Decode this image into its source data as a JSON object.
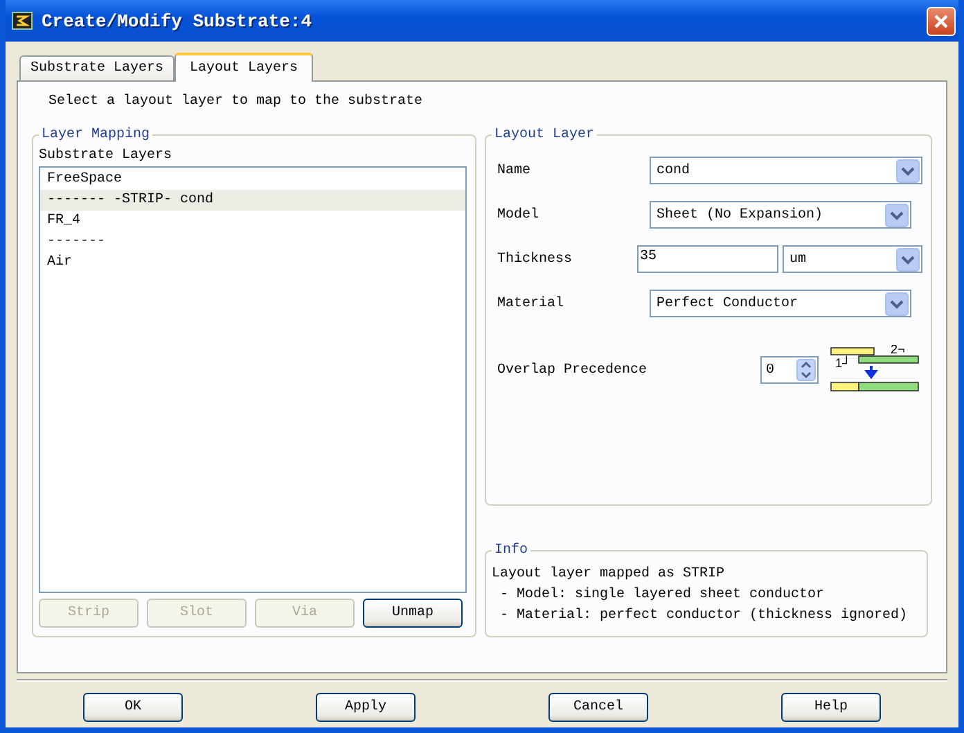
{
  "window": {
    "title": "Create/Modify Substrate:4"
  },
  "tabs": [
    {
      "label": "Substrate Layers",
      "selected": false
    },
    {
      "label": "Layout Layers",
      "selected": true
    }
  ],
  "instruction": "Select a layout layer to map to the substrate",
  "layer_mapping": {
    "title": "Layer Mapping",
    "list_label": "Substrate Layers",
    "items": [
      {
        "text": "FreeSpace",
        "selected": false
      },
      {
        "text": "------- -STRIP- cond",
        "selected": true
      },
      {
        "text": "FR_4",
        "selected": false
      },
      {
        "text": "-------",
        "selected": false
      },
      {
        "text": "Air",
        "selected": false
      }
    ],
    "buttons": [
      {
        "label": "Strip",
        "disabled": true
      },
      {
        "label": "Slot",
        "disabled": true
      },
      {
        "label": "Via",
        "disabled": true
      },
      {
        "label": "Unmap",
        "disabled": false
      }
    ]
  },
  "layout_layer": {
    "title": "Layout Layer",
    "fields": [
      {
        "kind": "combo",
        "label": "Name",
        "value": "cond"
      },
      {
        "kind": "combo",
        "label": "Model",
        "value": "Sheet (No Expansion)"
      },
      {
        "kind": "number_unit",
        "label": "Thickness",
        "value": "35",
        "unit": "um"
      },
      {
        "kind": "combo",
        "label": "Material",
        "value": "Perfect Conductor"
      }
    ],
    "overlap": {
      "label": "Overlap Precedence",
      "value": "0",
      "diagram_labels": [
        "2¬",
        "1┘"
      ]
    }
  },
  "info": {
    "title": "Info",
    "lines": [
      "Layout layer mapped as STRIP",
      " - Model: single layered sheet conductor",
      " - Material: perfect conductor (thickness ignored)"
    ]
  },
  "buttons": [
    "OK",
    "Apply",
    "Cancel",
    "Help"
  ]
}
